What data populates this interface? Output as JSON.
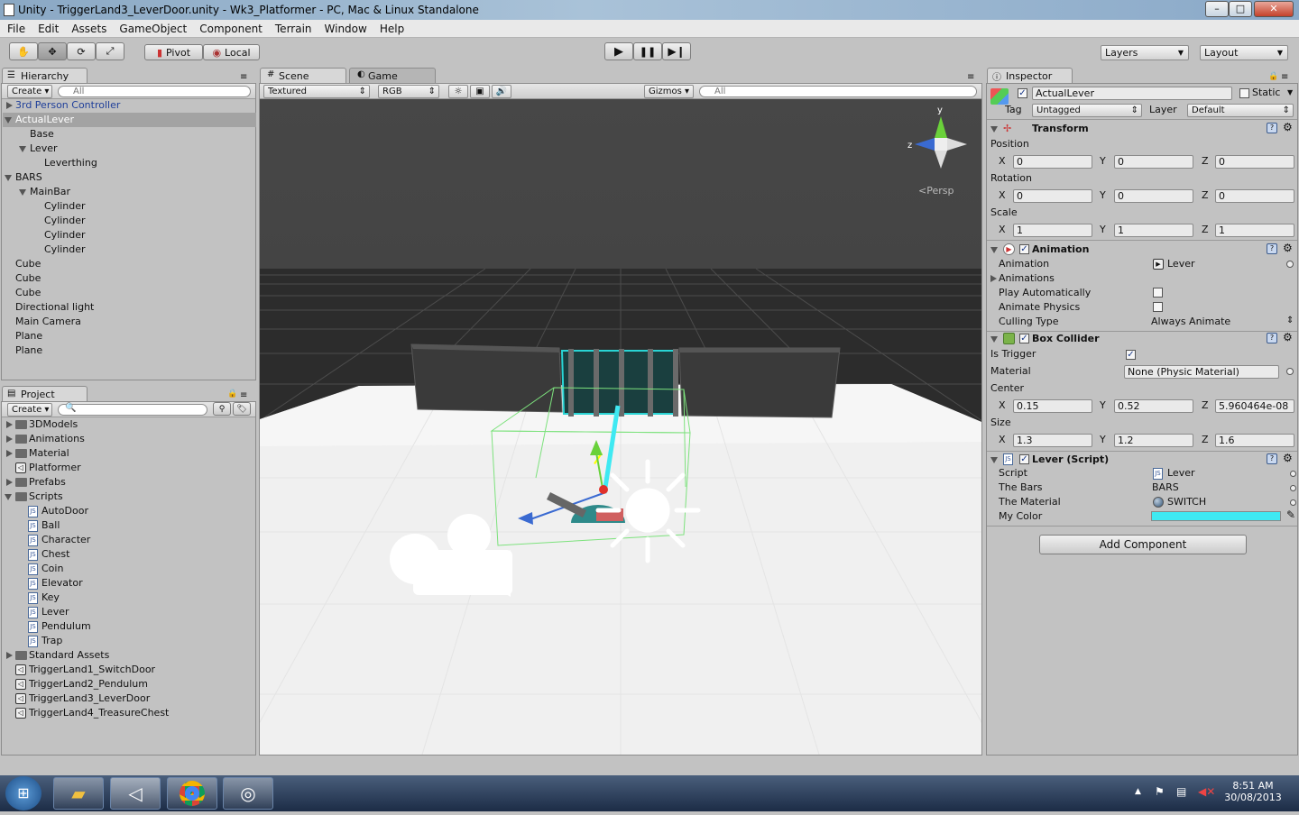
{
  "window": {
    "title": "Unity - TriggerLand3_LeverDoor.unity - Wk3_Platformer - PC, Mac & Linux Standalone",
    "min": "–",
    "max": "□",
    "close": "✕"
  },
  "menu": [
    "File",
    "Edit",
    "Assets",
    "GameObject",
    "Component",
    "Terrain",
    "Window",
    "Help"
  ],
  "toolbar": {
    "pivot": "Pivot",
    "local": "Local",
    "layers": "Layers",
    "layout": "Layout"
  },
  "hierarchy": {
    "tab": "Hierarchy",
    "create": "Create",
    "search_placeholder": "All",
    "items": [
      "3rd Person Controller",
      "ActualLever",
      "Base",
      "Lever",
      "Leverthing",
      "BARS",
      "MainBar",
      "Cylinder",
      "Cylinder",
      "Cylinder",
      "Cylinder",
      "Cube",
      "Cube",
      "Cube",
      "Directional light",
      "Main Camera",
      "Plane",
      "Plane"
    ]
  },
  "project": {
    "tab": "Project",
    "create": "Create",
    "items": [
      "3DModels",
      "Animations",
      "Material",
      "Platformer",
      "Prefabs",
      "Scripts",
      "AutoDoor",
      "Ball",
      "Character",
      "Chest",
      "Coin",
      "Elevator",
      "Key",
      "Lever",
      "Pendulum",
      "Trap",
      "Standard Assets",
      "TriggerLand1_SwitchDoor",
      "TriggerLand2_Pendulum",
      "TriggerLand3_LeverDoor",
      "TriggerLand4_TreasureChest"
    ]
  },
  "scene": {
    "tab_scene": "Scene",
    "tab_game": "Game",
    "render_mode": "Textured",
    "channel": "RGB",
    "gizmos": "Gizmos",
    "search_placeholder": "All",
    "persp": "Persp",
    "axis_y": "y",
    "axis_z": "z"
  },
  "inspector": {
    "tab": "Inspector",
    "object_name": "ActualLever",
    "static": "Static",
    "tag_label": "Tag",
    "tag": "Untagged",
    "layer_label": "Layer",
    "layer": "Default",
    "transform": {
      "title": "Transform",
      "position": "Position",
      "rotation": "Rotation",
      "scale": "Scale",
      "x": "X",
      "y": "Y",
      "z": "Z",
      "pos": [
        "0",
        "0",
        "0"
      ],
      "rot": [
        "0",
        "0",
        "0"
      ],
      "scl": [
        "1",
        "1",
        "1"
      ]
    },
    "animation": {
      "title": "Animation",
      "animation_label": "Animation",
      "animation_value": "Lever",
      "animations": "Animations",
      "play_auto": "Play Automatically",
      "animate_physics": "Animate Physics",
      "culling_label": "Culling Type",
      "culling_value": "Always Animate"
    },
    "box_collider": {
      "title": "Box Collider",
      "is_trigger": "Is Trigger",
      "material_label": "Material",
      "material_value": "None (Physic Material)",
      "center": "Center",
      "size": "Size",
      "center_vals": [
        "0.15",
        "0.52",
        "5.960464e-08"
      ],
      "size_vals": [
        "1.3",
        "1.2",
        "1.6"
      ]
    },
    "lever_script": {
      "title": "Lever (Script)",
      "script_label": "Script",
      "script_value": "Lever",
      "bars_label": "The Bars",
      "bars_value": "BARS",
      "material_label": "The Material",
      "material_value": "SWITCH",
      "color_label": "My Color",
      "color_value": "#3fe9f2"
    },
    "add_component": "Add Component"
  },
  "taskbar": {
    "time": "8:51 AM",
    "date": "30/08/2013"
  }
}
